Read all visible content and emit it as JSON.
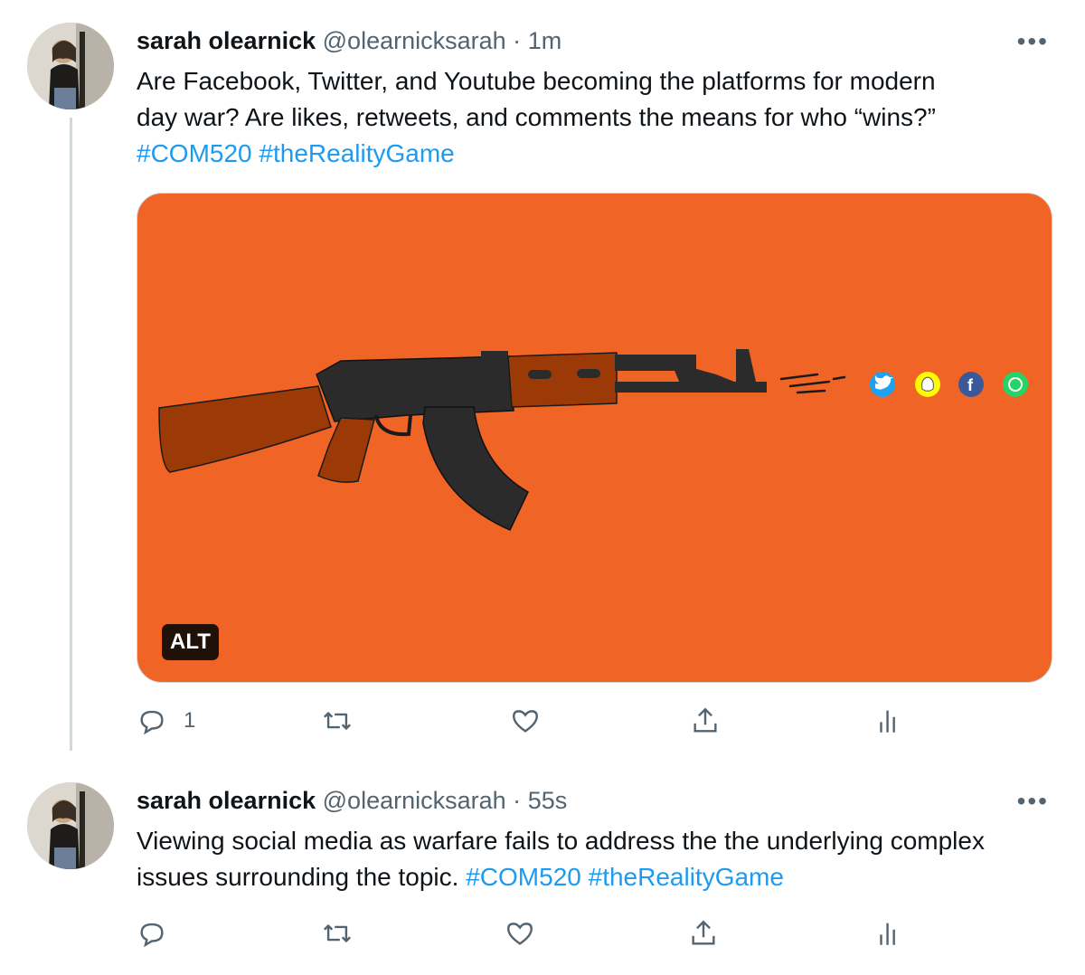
{
  "tweets": [
    {
      "author_name": "sarah olearnick",
      "handle": "@olearnicksarah",
      "separator": "·",
      "time": "1m",
      "more_label": "•••",
      "text_lines": [
        "Are Facebook, Twitter, and Youtube becoming the platforms for modern",
        "day war? Are likes, retweets, and comments the means for who “wins?”"
      ],
      "hashtags": [
        "#COM520",
        "#theRealityGame"
      ],
      "media": {
        "alt_badge": "ALT",
        "background_color": "#f06426",
        "social_icons": [
          "twitter-icon",
          "snapchat-icon",
          "facebook-icon",
          "whatsapp-icon"
        ]
      },
      "actions": {
        "reply_count": "1",
        "retweet_count": "",
        "like_count": "",
        "share_label": "",
        "analytics_label": ""
      }
    },
    {
      "author_name": "sarah olearnick",
      "handle": "@olearnicksarah",
      "separator": "·",
      "time": "55s",
      "more_label": "•••",
      "text_line_1": "Viewing social media as warfare fails to address the the underlying complex",
      "text_line_2": "issues surrounding the topic.",
      "hashtags": [
        "#COM520",
        "#theRealityGame"
      ],
      "actions": {
        "reply_count": "",
        "retweet_count": "",
        "like_count": ""
      }
    }
  ],
  "colors": {
    "hashtag": "#1d9bf0",
    "secondary_text": "#536471",
    "thread_line": "#cfd9de"
  }
}
